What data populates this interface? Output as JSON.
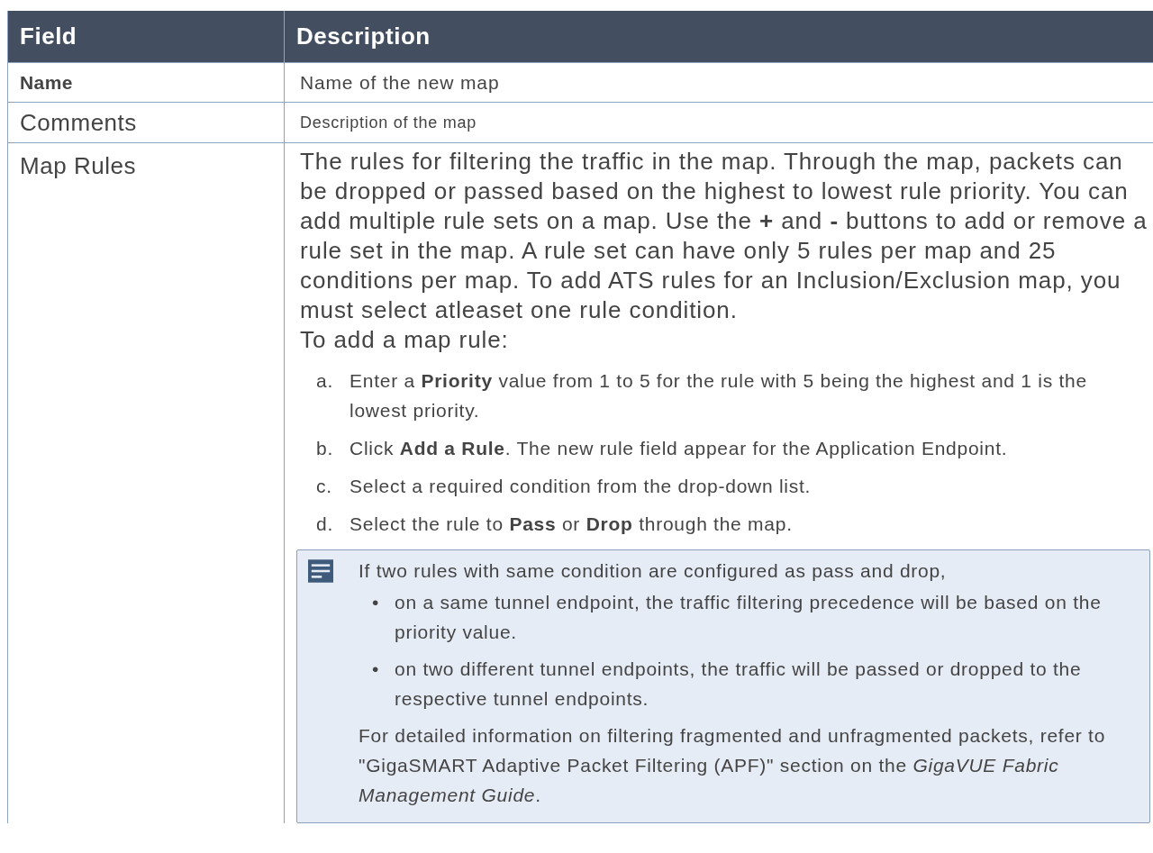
{
  "table": {
    "columns": [
      "Field",
      "Description"
    ],
    "rows": [
      {
        "field": "Name",
        "description": [
          {
            "kind": "paragraph",
            "text": "Name of the new map"
          }
        ]
      },
      {
        "field": "Comments",
        "description": [
          {
            "kind": "paragraph",
            "text": "Description of the map"
          }
        ]
      },
      {
        "field": "Map Rules",
        "description": [
          {
            "kind": "paragraph",
            "text": "The rules for filtering the traffic in the map. Through the map, packets can be dropped or passed based on the highest to lowest rule priority. You can add multiple rule sets on a map. Use the **+** and **-** buttons to add or remove a rule set in the map. A rule set can have only 5 rules per map and 25 conditions per map. To add ATS rules for an Inclusion/Exclusion map, you must select atleaset one rule condition."
          },
          {
            "kind": "paragraph",
            "text": "To add a map rule:"
          },
          {
            "kind": "steps",
            "items": [
              {
                "marker": "a.",
                "text": "Enter a **Priority** value from 1 to 5 for the rule with 5 being the highest and 1 is the lowest priority."
              },
              {
                "marker": "b.",
                "text": "Click **Add a Rule**. The new rule field appear for the Application Endpoint."
              },
              {
                "marker": "c.",
                "text": "Select a required condition from the drop-down list."
              },
              {
                "marker": "d.",
                "text": "Select the rule to **Pass** or **Drop** through the map."
              }
            ]
          },
          {
            "kind": "note",
            "intro": "If two rules with same condition are configured as pass and drop,",
            "bullets": [
              {
                "marker": "•",
                "text": "on a same tunnel endpoint, the traffic filtering precedence will be based on the priority value."
              },
              {
                "marker": "•",
                "text": "on two different tunnel endpoints, the traffic will be passed or dropped to the respective tunnel endpoints."
              }
            ],
            "outro": "For detailed information on filtering fragmented and unfragmented packets, refer to \"GigaSMART Adaptive Packet Filtering (APF)\" section on the *GigaVUE Fabric Management Guide*."
          }
        ]
      }
    ]
  }
}
